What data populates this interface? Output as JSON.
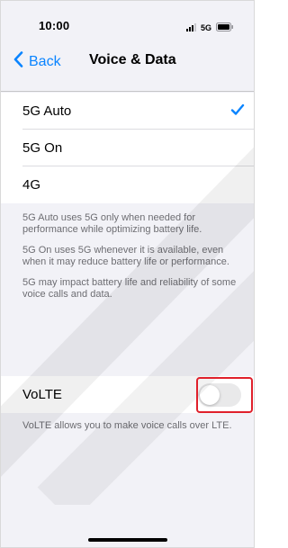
{
  "status_bar": {
    "time": "10:00",
    "network": "5G"
  },
  "nav": {
    "back_label": "Back",
    "title": "Voice & Data"
  },
  "options": [
    {
      "label": "5G Auto",
      "selected": true
    },
    {
      "label": "5G On",
      "selected": false
    },
    {
      "label": "4G",
      "selected": false
    }
  ],
  "options_footer": [
    "5G Auto uses 5G only when needed for performance while optimizing battery life.",
    "5G On uses 5G whenever it is available, even when it may reduce battery life or performance.",
    "5G may impact battery life and reliability of some voice calls and data."
  ],
  "volte": {
    "label": "VoLTE",
    "enabled": false,
    "footer": "VoLTE allows you to make voice calls over LTE."
  },
  "colors": {
    "accent": "#0a84ff",
    "highlight": "#e0202b",
    "background": "#f2f2f7"
  }
}
